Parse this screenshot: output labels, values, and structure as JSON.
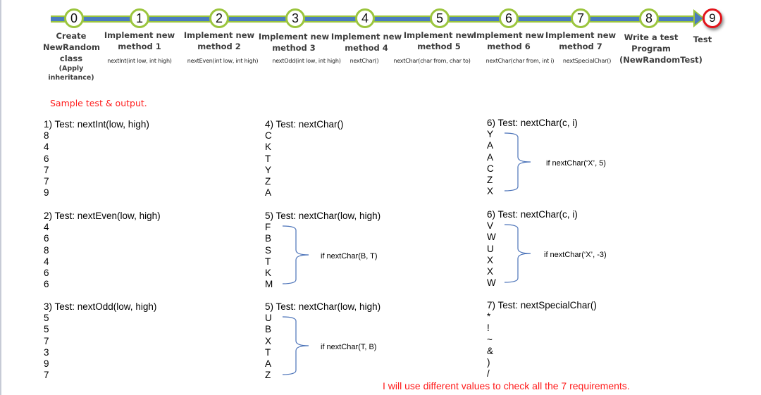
{
  "timeline": {
    "steps": [
      {
        "number": "0",
        "label": "Create NewRandom class",
        "sub": "(Apply inheritance)",
        "method": ""
      },
      {
        "number": "1",
        "label": "Implement new method 1",
        "sub": "",
        "method": "nextInt(int low, int high)"
      },
      {
        "number": "2",
        "label": "Implement new method 2",
        "sub": "",
        "method": "nextEven(int low, int high)"
      },
      {
        "number": "3",
        "label": "Implement new method 3",
        "sub": "",
        "method": "nextOdd(int low, int high)"
      },
      {
        "number": "4",
        "label": "Implement new method 4",
        "sub": "",
        "method": "nextChar()"
      },
      {
        "number": "5",
        "label": "Implement new method 5",
        "sub": "",
        "method": "nextChar(char from, char to)"
      },
      {
        "number": "6",
        "label": "Implement new method 6",
        "sub": "",
        "method": "nextChar(char from, int i)"
      },
      {
        "number": "7",
        "label": "Implement new method 7",
        "sub": "",
        "method": "nextSpecialChar()"
      },
      {
        "number": "8",
        "label": "Write a test Program",
        "sub": "(NewRandomTest)",
        "method": ""
      },
      {
        "number": "9",
        "label": "Test",
        "sub": "",
        "method": ""
      }
    ],
    "colors": {
      "track": "#4a7cc0",
      "node_ring": "#9bc53d",
      "final_ring": "#e3141b"
    }
  },
  "sample_heading": "Sample  test & output.",
  "tests": [
    {
      "title": "1) Test: nextInt(low, high)",
      "outputs": [
        "8",
        "4",
        "6",
        "7",
        "7",
        "9"
      ],
      "note": ""
    },
    {
      "title": "2) Test: nextEven(low, high)",
      "outputs": [
        "4",
        "6",
        "8",
        "4",
        "6",
        "6"
      ],
      "note": ""
    },
    {
      "title": "3) Test: nextOdd(low, high)",
      "outputs": [
        "5",
        "5",
        "7",
        "3",
        "9",
        "7"
      ],
      "note": ""
    },
    {
      "title": "4) Test: nextChar()",
      "outputs": [
        "C",
        "K",
        "T",
        "Y",
        "Z",
        "A"
      ],
      "note": ""
    },
    {
      "title": "5) Test: nextChar(low, high)",
      "outputs": [
        "F",
        "B",
        "S",
        "T",
        "K",
        "M"
      ],
      "note": "if nextChar(B, T)"
    },
    {
      "title": "5) Test: nextChar(low, high)",
      "outputs": [
        "U",
        "B",
        "X",
        "T",
        "A",
        "Z"
      ],
      "note": "if nextChar(T, B)"
    },
    {
      "title": "6) Test: nextChar(c, i)",
      "outputs": [
        "Y",
        "A",
        "A",
        "C",
        "Z",
        "X"
      ],
      "note": "if nextChar(‘X’, 5)"
    },
    {
      "title": "6) Test: nextChar(c, i)",
      "outputs": [
        "V",
        "W",
        "U",
        "X",
        "X",
        "W"
      ],
      "note": "if nextChar(‘X’, -3)"
    },
    {
      "title": "7) Test: nextSpecialChar()",
      "outputs": [
        "*",
        "!",
        "~",
        "&",
        ")",
        "/"
      ],
      "note": ""
    }
  ],
  "footer_note": "I will use different values to check all the 7 requirements.",
  "accent_colors": {
    "note_red": "#ff1a1a",
    "brace_blue": "#4a72b8"
  }
}
